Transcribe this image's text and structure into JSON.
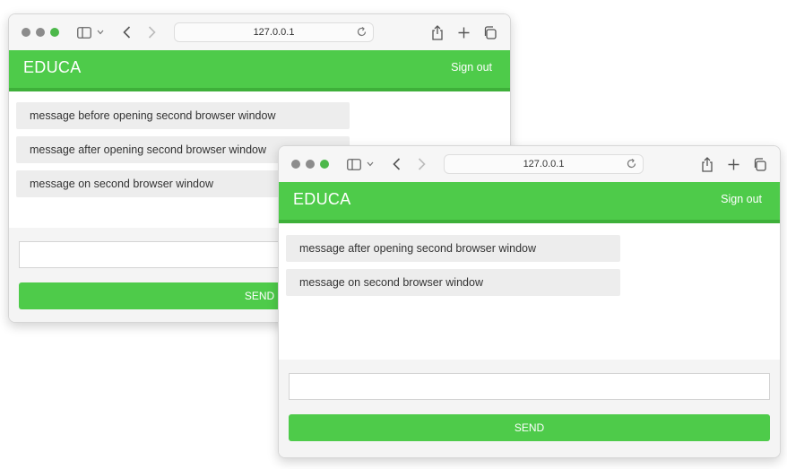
{
  "colors": {
    "green": "#4ecb4a",
    "green_dark": "#3eb03a",
    "message_bg": "#ededed",
    "page_bg": "#ffffff"
  },
  "browser": {
    "url": "127.0.0.1"
  },
  "app": {
    "brand": "EDUCA",
    "sign_out": "Sign out",
    "send_label": "SEND"
  },
  "window1": {
    "messages": [
      "message before opening second browser window",
      "message after opening second browser window",
      "message on second browser window"
    ]
  },
  "window2": {
    "messages": [
      "message after opening second browser window",
      "message on second browser window"
    ]
  }
}
